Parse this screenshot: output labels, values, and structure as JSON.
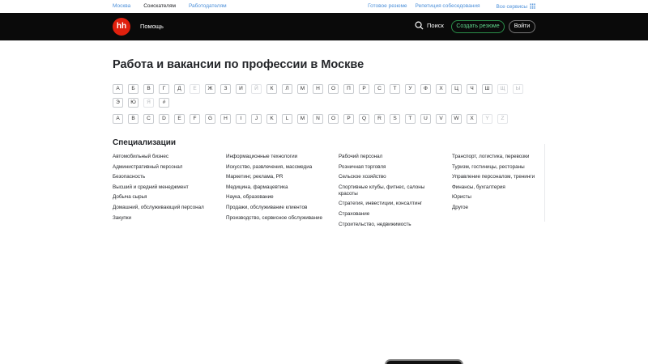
{
  "topbar": {
    "city": "Москва",
    "seekers": "Соискателям",
    "employers": "Работодателям",
    "right": [
      "Готовое резюме",
      "Репетиция собеседования",
      "Все сервисы"
    ]
  },
  "header": {
    "logo": "hh",
    "help": "Помощь",
    "search": "Поиск",
    "create_resume": "Создать резюме",
    "login": "Войти"
  },
  "title": "Работа и вакансии по профессии в Москве",
  "letters_ru": [
    {
      "l": "А",
      "dim": false
    },
    {
      "l": "Б",
      "dim": false
    },
    {
      "l": "В",
      "dim": false
    },
    {
      "l": "Г",
      "dim": false
    },
    {
      "l": "Д",
      "dim": false
    },
    {
      "l": "Е",
      "dim": true
    },
    {
      "l": "Ж",
      "dim": false
    },
    {
      "l": "З",
      "dim": false
    },
    {
      "l": "И",
      "dim": false
    },
    {
      "l": "Й",
      "dim": true
    },
    {
      "l": "К",
      "dim": false
    },
    {
      "l": "Л",
      "dim": false
    },
    {
      "l": "М",
      "dim": false
    },
    {
      "l": "Н",
      "dim": false
    },
    {
      "l": "О",
      "dim": false
    },
    {
      "l": "П",
      "dim": false
    },
    {
      "l": "Р",
      "dim": false
    },
    {
      "l": "С",
      "dim": false
    },
    {
      "l": "Т",
      "dim": false
    },
    {
      "l": "У",
      "dim": false
    },
    {
      "l": "Ф",
      "dim": false
    },
    {
      "l": "Х",
      "dim": false
    },
    {
      "l": "Ц",
      "dim": false
    },
    {
      "l": "Ч",
      "dim": false
    },
    {
      "l": "Ш",
      "dim": false
    },
    {
      "l": "Щ",
      "dim": true
    },
    {
      "l": "Ы",
      "dim": true
    },
    {
      "l": "Э",
      "dim": false
    },
    {
      "l": "Ю",
      "dim": false
    },
    {
      "l": "Я",
      "dim": true
    },
    {
      "l": "#",
      "dim": false
    }
  ],
  "letters_en": [
    {
      "l": "A",
      "dim": false
    },
    {
      "l": "B",
      "dim": false
    },
    {
      "l": "C",
      "dim": false
    },
    {
      "l": "D",
      "dim": false
    },
    {
      "l": "E",
      "dim": false
    },
    {
      "l": "F",
      "dim": false
    },
    {
      "l": "G",
      "dim": false
    },
    {
      "l": "H",
      "dim": false
    },
    {
      "l": "I",
      "dim": false
    },
    {
      "l": "J",
      "dim": false
    },
    {
      "l": "K",
      "dim": false
    },
    {
      "l": "L",
      "dim": false
    },
    {
      "l": "M",
      "dim": false
    },
    {
      "l": "N",
      "dim": false
    },
    {
      "l": "O",
      "dim": false
    },
    {
      "l": "P",
      "dim": false
    },
    {
      "l": "Q",
      "dim": false
    },
    {
      "l": "R",
      "dim": false
    },
    {
      "l": "S",
      "dim": false
    },
    {
      "l": "T",
      "dim": false
    },
    {
      "l": "U",
      "dim": false
    },
    {
      "l": "V",
      "dim": false
    },
    {
      "l": "W",
      "dim": false
    },
    {
      "l": "X",
      "dim": false
    },
    {
      "l": "Y",
      "dim": true
    },
    {
      "l": "Z",
      "dim": true
    }
  ],
  "specializations_title": "Специализации",
  "columns": [
    [
      "Автомобильный бизнес",
      "Административный персонал",
      "Безопасность",
      "Высший и средний менеджмент",
      "Добыча сырья",
      "Домашний, обслуживающий персонал",
      "Закупки"
    ],
    [
      "Информационные технологии",
      "Искусство, развлечения, массмедиа",
      "Маркетинг, реклама, PR",
      "Медицина, фармацевтика",
      "Наука, образование",
      "Продажи, обслуживание клиентов",
      "Производство, сервисное обслуживание"
    ],
    [
      "Рабочий персонал",
      "Розничная торговля",
      "Сельское хозяйство",
      "Спортивные клубы, фитнес, салоны красоты",
      "Стратегия, инвестиции, консалтинг",
      "Страхование",
      "Строительство, недвижимость"
    ],
    [
      "Транспорт, логистика, перевозки",
      "Туризм, гостиницы, рестораны",
      "Управление персоналом, тренинги",
      "Финансы, бухгалтерия",
      "Юристы",
      "Другое"
    ]
  ],
  "colors": {
    "brand": "#e0200d",
    "header_bg": "#0a0a0a",
    "link": "#4b8fd9",
    "accent_green": "#5fd38a"
  }
}
